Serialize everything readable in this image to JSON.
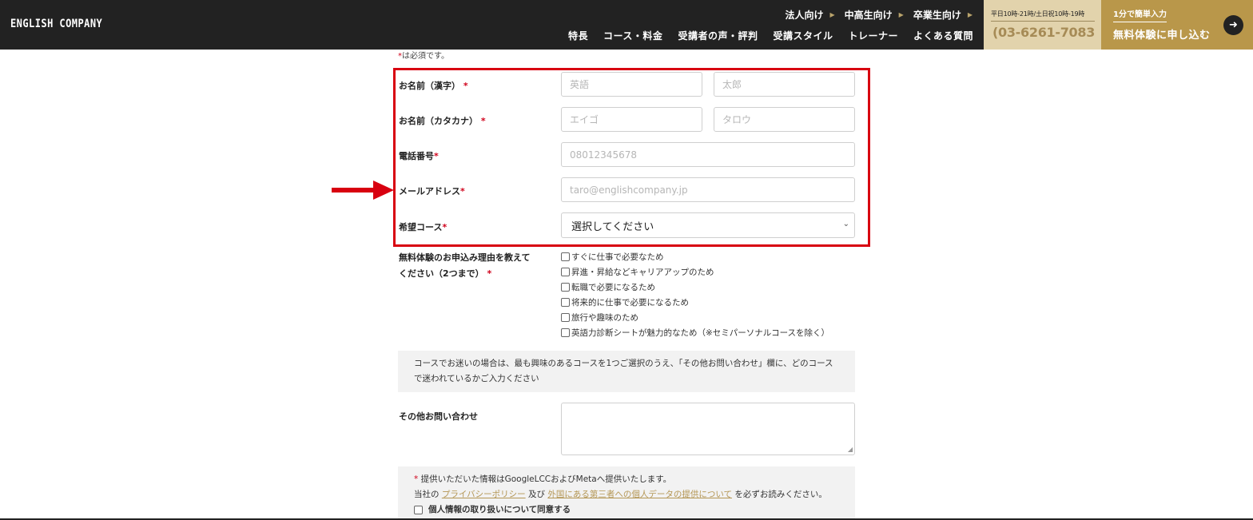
{
  "header": {
    "logo": "ENGLISH COMPANY",
    "top_links": [
      "法人向け",
      "中高生向け",
      "卒業生向け"
    ],
    "nav": [
      "特長",
      "コース・料金",
      "受講者の声・評判",
      "受講スタイル",
      "トレーナー",
      "よくある質問"
    ],
    "phone": {
      "hours": "平日10時-21時/土日祝10時-19時",
      "number": "03-6261-7083"
    },
    "cta": {
      "sub": "1分で簡単入力",
      "main": "無料体験に申し込む"
    }
  },
  "form": {
    "required_note": "は必須です。",
    "required_mark": "*",
    "name_kanji": {
      "label": "お名前（漢字）",
      "last_placeholder": "英語",
      "first_placeholder": "太郎"
    },
    "name_kana": {
      "label": "お名前（カタカナ）",
      "last_placeholder": "エイゴ",
      "first_placeholder": "タロウ"
    },
    "phone": {
      "label": "電話番号",
      "placeholder": "08012345678"
    },
    "email": {
      "label": "メールアドレス",
      "placeholder": "taro@englishcompany.jp"
    },
    "course": {
      "label": "希望コース",
      "selected": "選択してください"
    },
    "reason": {
      "label_line1": "無料体験のお申込み理由を教えて",
      "label_line2": "ください（2つまで）",
      "options": [
        "すぐに仕事で必要なため",
        "昇進・昇給などキャリアアップのため",
        "転職で必要になるため",
        "将来的に仕事で必要になるため",
        "旅行や趣味のため",
        "英語力診断シートが魅力的なため（※セミパーソナルコースを除く）"
      ]
    },
    "info": {
      "line1": "コースでお迷いの場合は、最も興味のあるコースを1つご選択のうえ、「その他お問い合わせ」欄に、どのコース",
      "line2": "で迷われているかご入力ください"
    },
    "other": {
      "label": "その他お問い合わせ"
    },
    "consent": {
      "line1": "提供いただいた情報はGoogleLCCおよびMetaへ提供いたします。",
      "line2_prefix": "当社の",
      "privacy_link": "プライバシーポリシー",
      "line2_mid": "及び",
      "thirdparty_link": "外国にある第三者への個人データの提供について",
      "line2_suffix": "を必ずお読みください。",
      "agree": "個人情報の取り扱いについて同意する"
    }
  },
  "colors": {
    "header_bg": "#222222",
    "gold": "#b9974a",
    "phone_bg": "#e2d3ac",
    "required_red": "#d0021b",
    "highlight_red": "#d80010"
  }
}
